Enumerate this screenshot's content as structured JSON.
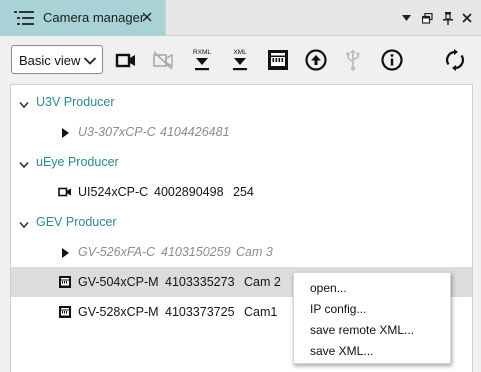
{
  "window": {
    "tab_title": "Camera manager",
    "icons": {
      "tab": "list-icon",
      "close": "close-icon",
      "dropdown": "chevron-down-icon",
      "restore": "restore-icon",
      "pin": "pin-icon",
      "close_window": "close-icon"
    }
  },
  "toolbar": {
    "view_select": {
      "value": "Basic view",
      "options": [
        "Basic view"
      ]
    },
    "buttons": [
      {
        "name": "open-camera-button",
        "icon": "camera-icon"
      },
      {
        "name": "close-camera-button",
        "icon": "camera-off-icon",
        "disabled": true
      },
      {
        "name": "save-remote-xml-button",
        "icon": "download-rxml-icon",
        "label": "RXML"
      },
      {
        "name": "save-xml-button",
        "icon": "download-xml-icon",
        "label": "XML"
      },
      {
        "name": "ip-config-button",
        "icon": "ethernet-icon"
      },
      {
        "name": "upload-button",
        "icon": "upload-circle-icon"
      },
      {
        "name": "usb-button",
        "icon": "usb-icon",
        "disabled": true
      },
      {
        "name": "info-button",
        "icon": "info-icon"
      },
      {
        "name": "refresh-button",
        "icon": "refresh-icon"
      }
    ]
  },
  "tree": {
    "producers": [
      {
        "label": "U3V Producer",
        "devices": [
          {
            "model": "U3-307xCP-C",
            "serial": "4104426481",
            "extra": "",
            "state": "unavailable",
            "icon": "play-icon"
          }
        ]
      },
      {
        "label": "uEye Producer",
        "devices": [
          {
            "model": "UI524xCP-C",
            "serial": "4002890498",
            "extra": "254",
            "state": "available",
            "icon": "camera-icon"
          }
        ]
      },
      {
        "label": "GEV Producer",
        "devices": [
          {
            "model": "GV-526xFA-C",
            "serial": "4103150259",
            "extra": "Cam 3",
            "state": "unavailable",
            "icon": "play-icon"
          },
          {
            "model": "GV-504xCP-M",
            "serial": "4103335273",
            "extra": "Cam 2",
            "state": "selected",
            "icon": "ethernet-icon"
          },
          {
            "model": "GV-528xCP-M",
            "serial": "4103373725",
            "extra": "Cam1",
            "state": "available",
            "icon": "ethernet-icon"
          }
        ]
      }
    ]
  },
  "context_menu": {
    "items": [
      "open...",
      "IP config...",
      "save remote XML...",
      "save XML..."
    ]
  },
  "colors": {
    "tab_active": "#a9d2d6",
    "producer_label": "#2a8a94",
    "selected_row": "#dcdcdc",
    "disabled_text": "#8c8c8c"
  }
}
